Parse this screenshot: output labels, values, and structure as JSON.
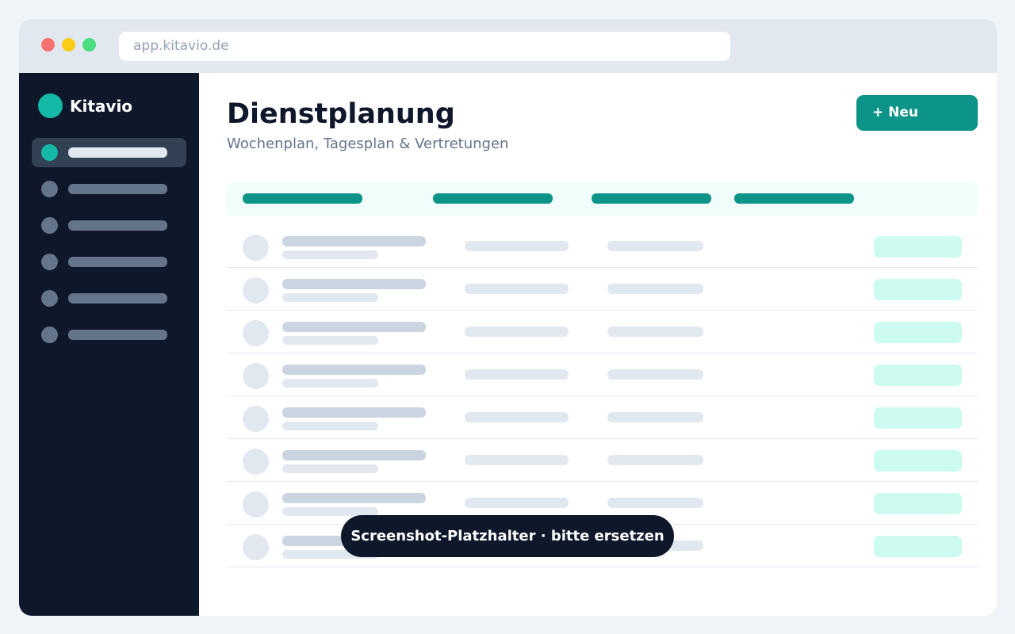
{
  "browser": {
    "url": "app.kitavio.de",
    "traffic_lights": [
      "#f87171",
      "#facc15",
      "#4ade80"
    ]
  },
  "colors": {
    "accent": "#0d9488",
    "accent_light": "#14b8a6",
    "pill": "#ccfbf1",
    "sidebar_bg": "#0f172a"
  },
  "sidebar": {
    "brand": "Kitavio",
    "nav_items": [
      {
        "active": true
      },
      {
        "active": false
      },
      {
        "active": false
      },
      {
        "active": false
      },
      {
        "active": false
      },
      {
        "active": false
      }
    ]
  },
  "main": {
    "title": "Dienstplanung",
    "subtitle": "Wochenplan, Tagesplan & Vertretungen",
    "new_button": "+ Neu"
  },
  "table": {
    "header_columns": 4,
    "row_count": 8
  },
  "placeholder_badge": "Screenshot-Platzhalter · bitte ersetzen"
}
